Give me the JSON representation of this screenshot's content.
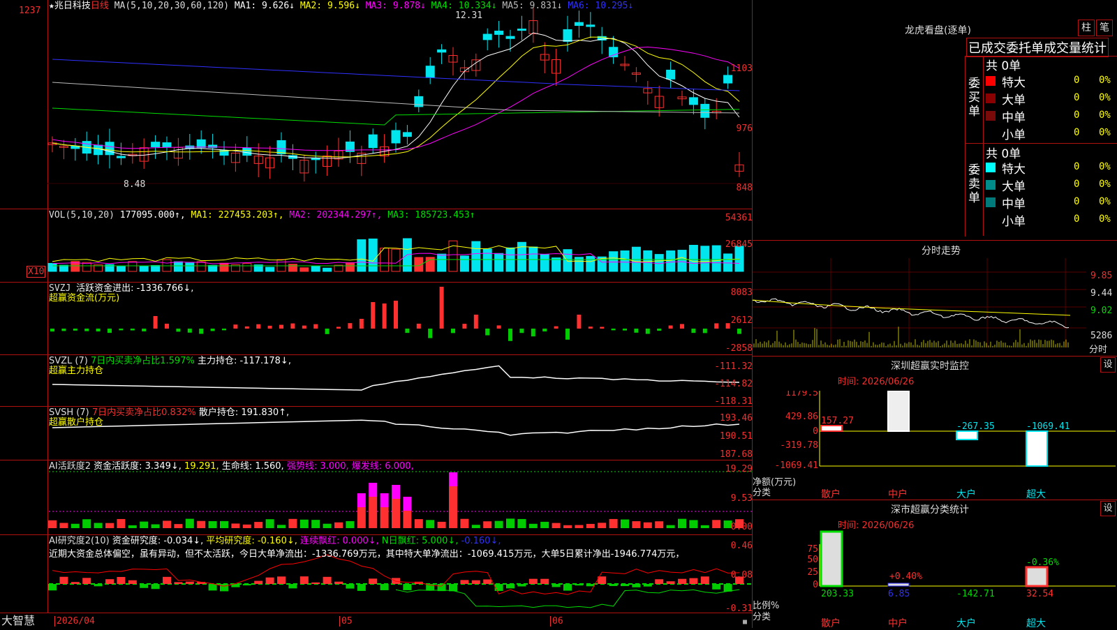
{
  "colors": {
    "up": "#ff3030",
    "down": "#00e5ee",
    "bg": "#000000",
    "border": "#b01010",
    "ma1": "#ffffff",
    "ma2": "#ffff00",
    "ma3": "#ff00ff",
    "ma4": "#00dd00",
    "ma5": "#bbbbbb",
    "ma6": "#3030ff"
  },
  "top_axis": {
    "top_value": "1237"
  },
  "main": {
    "title_star": "★",
    "stock": "兆日科技",
    "period": "日线",
    "ma_label": "MA(5,10,20,30,60,120)",
    "ma1": "MA1: 9.626↓",
    "ma2": "MA2: 9.596↓",
    "ma3": "MA3: 9.878↓",
    "ma4": "MA4: 10.334↓",
    "ma5": "MA5: 9.831↓",
    "ma6": "MA6: 10.295↓",
    "high_mark": "12.31",
    "low_mark": "8.48",
    "y_ticks": [
      "1103",
      "976",
      "848"
    ]
  },
  "vol": {
    "label": "VOL(5,10,20)",
    "value": "177095.000↑,",
    "ma1": "MA1: 227453.203↑,",
    "ma2": "MA2: 202344.297↑,",
    "ma3": "MA3: 185723.453↑",
    "y_ticks": [
      "54361",
      "26845"
    ],
    "multiplier": "X10"
  },
  "svzj": {
    "label": "SVZJ",
    "text": "活跃资金进出: -1336.766↓,",
    "sub": "超赢资金流(万元)",
    "y_ticks": [
      "8083",
      "2612",
      "-2858"
    ]
  },
  "svzl": {
    "label": "SVZL (7)",
    "text_a": "7日内买卖净占比1.597%",
    "text_b": "主力持仓: -117.178↓,",
    "sub": "超赢主力持仓",
    "y_ticks": [
      "-111.32",
      "-114.82",
      "-118.31"
    ]
  },
  "svsh": {
    "label": "SVSH (7)",
    "text_a": "7日内买卖净占比0.832%",
    "text_b": "散户持仓: 191.830↑,",
    "sub": "超赢散户持仓",
    "y_ticks": [
      "193.46",
      "190.51",
      "187.68"
    ]
  },
  "ai1": {
    "label": "AI活跃度2",
    "t1": "资金活跃度: 3.349↓,",
    "t2": "19.291,",
    "t3": "生命线: 1.560,",
    "t4": "强势线: 3.000,",
    "t5": "爆发线: 6.000,",
    "y_ticks": [
      "19.29",
      "9.53",
      "0.00"
    ]
  },
  "ai2": {
    "label": "AI研究度2(10)",
    "t1": "资金研究度: -0.034↓,",
    "t2": "平均研究度: -0.160↓,",
    "t3": "连续飘红: 0.000↓,",
    "t4": "N日飘红: 5.000↓,",
    "t5": "-0.160↓,",
    "desc": "近期大资金总体偏空，虽有异动，但不太活跃，今日大单净流出：-1336.769万元，其中特大单净流出：-1069.415万元，大单5日累计净出-1946.774万元，",
    "y_ticks": [
      "0.46",
      "0.08",
      "-0.31"
    ]
  },
  "bottom": {
    "brand": "大智慧",
    "date": "2026/04",
    "m1": "05",
    "m2": "06"
  },
  "right": {
    "lhkp_title": "龙虎看盘(逐单)",
    "btn_zhu": "柱",
    "btn_bi": "笔",
    "stat_title": "已成交委托单成交量统计",
    "buy": {
      "side": "委买单",
      "total": "共 0单",
      "rows": [
        {
          "name": "特大",
          "v": "0",
          "p": "0%",
          "c": "#ff0000"
        },
        {
          "name": "大单",
          "v": "0",
          "p": "0%",
          "c": "#8b0000"
        },
        {
          "name": "中单",
          "v": "0",
          "p": "0%",
          "c": "#7a0a0a"
        },
        {
          "name": "小单",
          "v": "0",
          "p": "0%",
          "c": "#000000"
        }
      ]
    },
    "sell": {
      "side": "委卖单",
      "total": "共 0单",
      "rows": [
        {
          "name": "特大",
          "v": "0",
          "p": "0%",
          "c": "#00ffff"
        },
        {
          "name": "大单",
          "v": "0",
          "p": "0%",
          "c": "#008b8b"
        },
        {
          "name": "中单",
          "v": "0",
          "p": "0%",
          "c": "#007a7a"
        },
        {
          "name": "小单",
          "v": "0",
          "p": "0%",
          "c": "#000000"
        }
      ]
    },
    "fs_title": "分时走势",
    "fs_y": [
      "9.85",
      "9.44",
      "9.02",
      "5286"
    ],
    "fs_unit": "分时",
    "sz_title": "深圳超赢实时监控",
    "sz_btn": "设",
    "sz_time": "时间: 2026/06/26",
    "sz_y": [
      "1179.5",
      "429.86",
      "0",
      "-319.78",
      "-1069.41"
    ],
    "sz_vals": [
      "157.27",
      "1179.5",
      "-267.35",
      "-1069.41"
    ],
    "sz_unit": "净额(万元)",
    "sz_cls": "分类",
    "sz_cats": [
      "散户",
      "中户",
      "大户",
      "超大"
    ],
    "ss_title": "深市超赢分类统计",
    "ss_btn": "设",
    "ss_time": "时间: 2026/06/26",
    "ss_y": [
      "75",
      "50",
      "25",
      "0"
    ],
    "ss_pct": [
      "+0.40%",
      "-0.36%"
    ],
    "ss_vals": [
      "203.33",
      "6.85",
      "-142.71",
      "32.54"
    ],
    "ss_unit": "比例%",
    "ss_cls": "分类",
    "ss_cats": [
      "散户",
      "中户",
      "大户",
      "超大"
    ]
  }
}
